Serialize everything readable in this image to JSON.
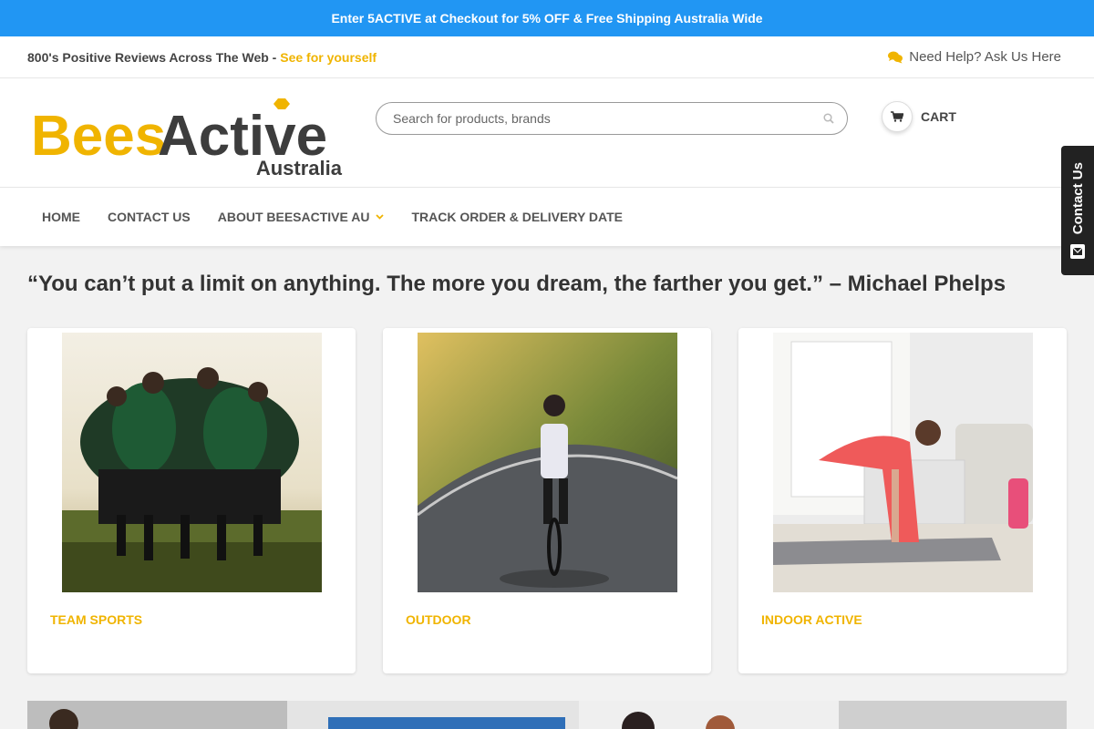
{
  "promo": {
    "text": "Enter 5ACTIVE at Checkout for 5% OFF & Free Shipping Australia Wide"
  },
  "topbar": {
    "reviews_text": "800's Positive Reviews Across The Web - ",
    "reviews_link": "See for yourself",
    "help_text": "Need Help? Ask Us Here"
  },
  "logo": {
    "text_bees": "Bees",
    "text_active": "Active",
    "text_sub": "Australia"
  },
  "search": {
    "placeholder": "Search for products, brands"
  },
  "cart": {
    "label": "CART"
  },
  "nav": {
    "items": [
      {
        "label": "HOME"
      },
      {
        "label": "CONTACT US"
      },
      {
        "label": "ABOUT BEESACTIVE AU"
      },
      {
        "label": "TRACK ORDER & DELIVERY DATE"
      }
    ]
  },
  "contact_tab": {
    "label": "Contact Us"
  },
  "quote": "“You can’t put a limit on anything. The more you dream, the farther you get.” – Michael Phelps",
  "categories": [
    {
      "title": "TEAM SPORTS"
    },
    {
      "title": "OUTDOOR"
    },
    {
      "title": "INDOOR ACTIVE"
    }
  ],
  "colors": {
    "promo_bg": "#2196f3",
    "accent": "#f0b400",
    "text": "#333333"
  }
}
